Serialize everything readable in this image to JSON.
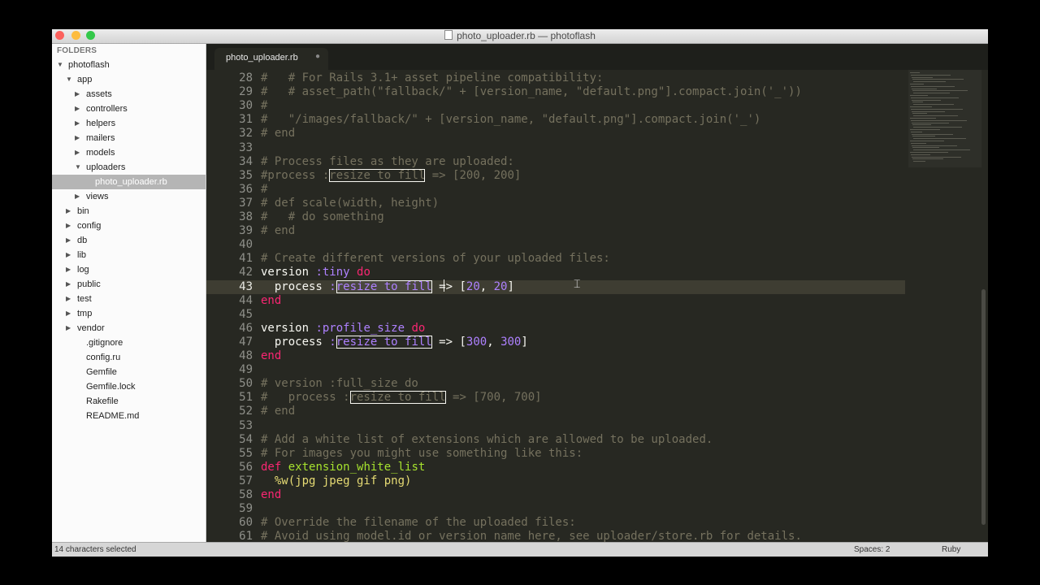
{
  "window": {
    "title": "photo_uploader.rb — photoflash",
    "traffic_lights": {
      "close_color": "#fc615d",
      "minimize_color": "#fdbc40",
      "zoom_color": "#34c84a"
    }
  },
  "sidebar": {
    "header": "FOLDERS",
    "tree": [
      {
        "label": "photoflash",
        "arrow": "expanded"
      },
      {
        "label": "app",
        "arrow": "expanded"
      },
      {
        "label": "assets",
        "arrow": "collapsed"
      },
      {
        "label": "controllers",
        "arrow": "collapsed"
      },
      {
        "label": "helpers",
        "arrow": "collapsed"
      },
      {
        "label": "mailers",
        "arrow": "collapsed"
      },
      {
        "label": "models",
        "arrow": "collapsed"
      },
      {
        "label": "uploaders",
        "arrow": "expanded"
      },
      {
        "label": "photo_uploader.rb",
        "arrow": "none",
        "selected": true
      },
      {
        "label": "views",
        "arrow": "collapsed"
      },
      {
        "label": "bin",
        "arrow": "collapsed"
      },
      {
        "label": "config",
        "arrow": "collapsed"
      },
      {
        "label": "db",
        "arrow": "collapsed"
      },
      {
        "label": "lib",
        "arrow": "collapsed"
      },
      {
        "label": "log",
        "arrow": "collapsed"
      },
      {
        "label": "public",
        "arrow": "collapsed"
      },
      {
        "label": "test",
        "arrow": "collapsed"
      },
      {
        "label": "tmp",
        "arrow": "collapsed"
      },
      {
        "label": "vendor",
        "arrow": "collapsed"
      },
      {
        "label": ".gitignore",
        "arrow": "none"
      },
      {
        "label": "config.ru",
        "arrow": "none"
      },
      {
        "label": "Gemfile",
        "arrow": "none"
      },
      {
        "label": "Gemfile.lock",
        "arrow": "none"
      },
      {
        "label": "Rakefile",
        "arrow": "none"
      },
      {
        "label": "README.md",
        "arrow": "none"
      }
    ]
  },
  "tabs": [
    {
      "label": "photo_uploader.rb",
      "active": true,
      "close_glyph": "●"
    }
  ],
  "editor": {
    "current_line": 43,
    "lines": [
      {
        "num": "28",
        "tokens": [
          {
            "t": "#   # For Rails 3.1+ asset pipeline compatibility:",
            "c": "c"
          }
        ]
      },
      {
        "num": "29",
        "tokens": [
          {
            "t": "#   # asset_path(\"fallback/\" + [version_name, \"default.png\"].compact.join('_'))",
            "c": "c"
          }
        ]
      },
      {
        "num": "30",
        "tokens": [
          {
            "t": "#",
            "c": "c"
          }
        ]
      },
      {
        "num": "31",
        "tokens": [
          {
            "t": "#   \"/images/fallback/\" + [version_name, \"default.png\"].compact.join('_')",
            "c": "c"
          }
        ]
      },
      {
        "num": "32",
        "tokens": [
          {
            "t": "# end",
            "c": "c"
          }
        ]
      },
      {
        "num": "33",
        "tokens": []
      },
      {
        "num": "34",
        "tokens": [
          {
            "t": "# Process files as they are uploaded:",
            "c": "c"
          }
        ]
      },
      {
        "num": "35",
        "tokens": [
          {
            "t": "#process :",
            "c": "c"
          },
          {
            "t": "resize_to_fill",
            "c": "c",
            "box": true
          },
          {
            "t": " => [200, 200]",
            "c": "c"
          }
        ]
      },
      {
        "num": "36",
        "tokens": [
          {
            "t": "#",
            "c": "c"
          }
        ]
      },
      {
        "num": "37",
        "tokens": [
          {
            "t": "# def scale(width, height)",
            "c": "c"
          }
        ]
      },
      {
        "num": "38",
        "tokens": [
          {
            "t": "#   # do something",
            "c": "c"
          }
        ]
      },
      {
        "num": "39",
        "tokens": [
          {
            "t": "# end",
            "c": "c"
          }
        ]
      },
      {
        "num": "40",
        "tokens": []
      },
      {
        "num": "41",
        "tokens": [
          {
            "t": "# Create different versions of your uploaded files:",
            "c": "c"
          }
        ]
      },
      {
        "num": "42",
        "tokens": [
          {
            "t": "version ",
            "c": "p"
          },
          {
            "t": ":tiny",
            "c": "s"
          },
          {
            "t": " ",
            "c": "p"
          },
          {
            "t": "do",
            "c": "k"
          }
        ]
      },
      {
        "num": "43",
        "tokens": [
          {
            "t": "  process ",
            "c": "p"
          },
          {
            "t": ":",
            "c": "s"
          },
          {
            "t": "resize_to_fill",
            "c": "s",
            "box": true,
            "sel": true
          },
          {
            "t": " => [",
            "c": "p"
          },
          {
            "t": "20",
            "c": "n"
          },
          {
            "t": ", ",
            "c": "p"
          },
          {
            "t": "20",
            "c": "n"
          },
          {
            "t": "]",
            "c": "p"
          }
        ]
      },
      {
        "num": "44",
        "tokens": [
          {
            "t": "end",
            "c": "k"
          }
        ]
      },
      {
        "num": "45",
        "tokens": []
      },
      {
        "num": "46",
        "tokens": [
          {
            "t": "version ",
            "c": "p"
          },
          {
            "t": ":profile_size",
            "c": "s"
          },
          {
            "t": " ",
            "c": "p"
          },
          {
            "t": "do",
            "c": "k"
          }
        ]
      },
      {
        "num": "47",
        "tokens": [
          {
            "t": "  process ",
            "c": "p"
          },
          {
            "t": ":",
            "c": "s"
          },
          {
            "t": "resize_to_fill",
            "c": "s",
            "box": true
          },
          {
            "t": " => [",
            "c": "p"
          },
          {
            "t": "300",
            "c": "n"
          },
          {
            "t": ", ",
            "c": "p"
          },
          {
            "t": "300",
            "c": "n"
          },
          {
            "t": "]",
            "c": "p"
          }
        ]
      },
      {
        "num": "48",
        "tokens": [
          {
            "t": "end",
            "c": "k"
          }
        ]
      },
      {
        "num": "49",
        "tokens": []
      },
      {
        "num": "50",
        "tokens": [
          {
            "t": "# version :full_size do",
            "c": "c"
          }
        ]
      },
      {
        "num": "51",
        "tokens": [
          {
            "t": "#   process :",
            "c": "c"
          },
          {
            "t": "resize_to_fill",
            "c": "c",
            "box": true
          },
          {
            "t": " => [700, 700]",
            "c": "c"
          }
        ]
      },
      {
        "num": "52",
        "tokens": [
          {
            "t": "# end",
            "c": "c"
          }
        ]
      },
      {
        "num": "53",
        "tokens": []
      },
      {
        "num": "54",
        "tokens": [
          {
            "t": "# Add a white list of extensions which are allowed to be uploaded.",
            "c": "c"
          }
        ]
      },
      {
        "num": "55",
        "tokens": [
          {
            "t": "# For images you might use something like this:",
            "c": "c"
          }
        ]
      },
      {
        "num": "56",
        "tokens": [
          {
            "t": "def",
            "c": "k"
          },
          {
            "t": " ",
            "c": "p"
          },
          {
            "t": "extension_white_list",
            "c": "f"
          }
        ]
      },
      {
        "num": "57",
        "tokens": [
          {
            "t": "  %w(jpg jpeg gif png)",
            "c": "y"
          }
        ]
      },
      {
        "num": "58",
        "tokens": [
          {
            "t": "end",
            "c": "k"
          }
        ]
      },
      {
        "num": "59",
        "tokens": []
      },
      {
        "num": "60",
        "tokens": [
          {
            "t": "# Override the filename of the uploaded files:",
            "c": "c"
          }
        ]
      },
      {
        "num": "61",
        "tokens": [
          {
            "t": "# Avoid using model.id or version_name here, see uploader/store.rb for details.",
            "c": "c"
          }
        ]
      }
    ]
  },
  "statusbar": {
    "selection": "14 characters selected",
    "indentation": "Spaces: 2",
    "syntax": "Ruby"
  }
}
